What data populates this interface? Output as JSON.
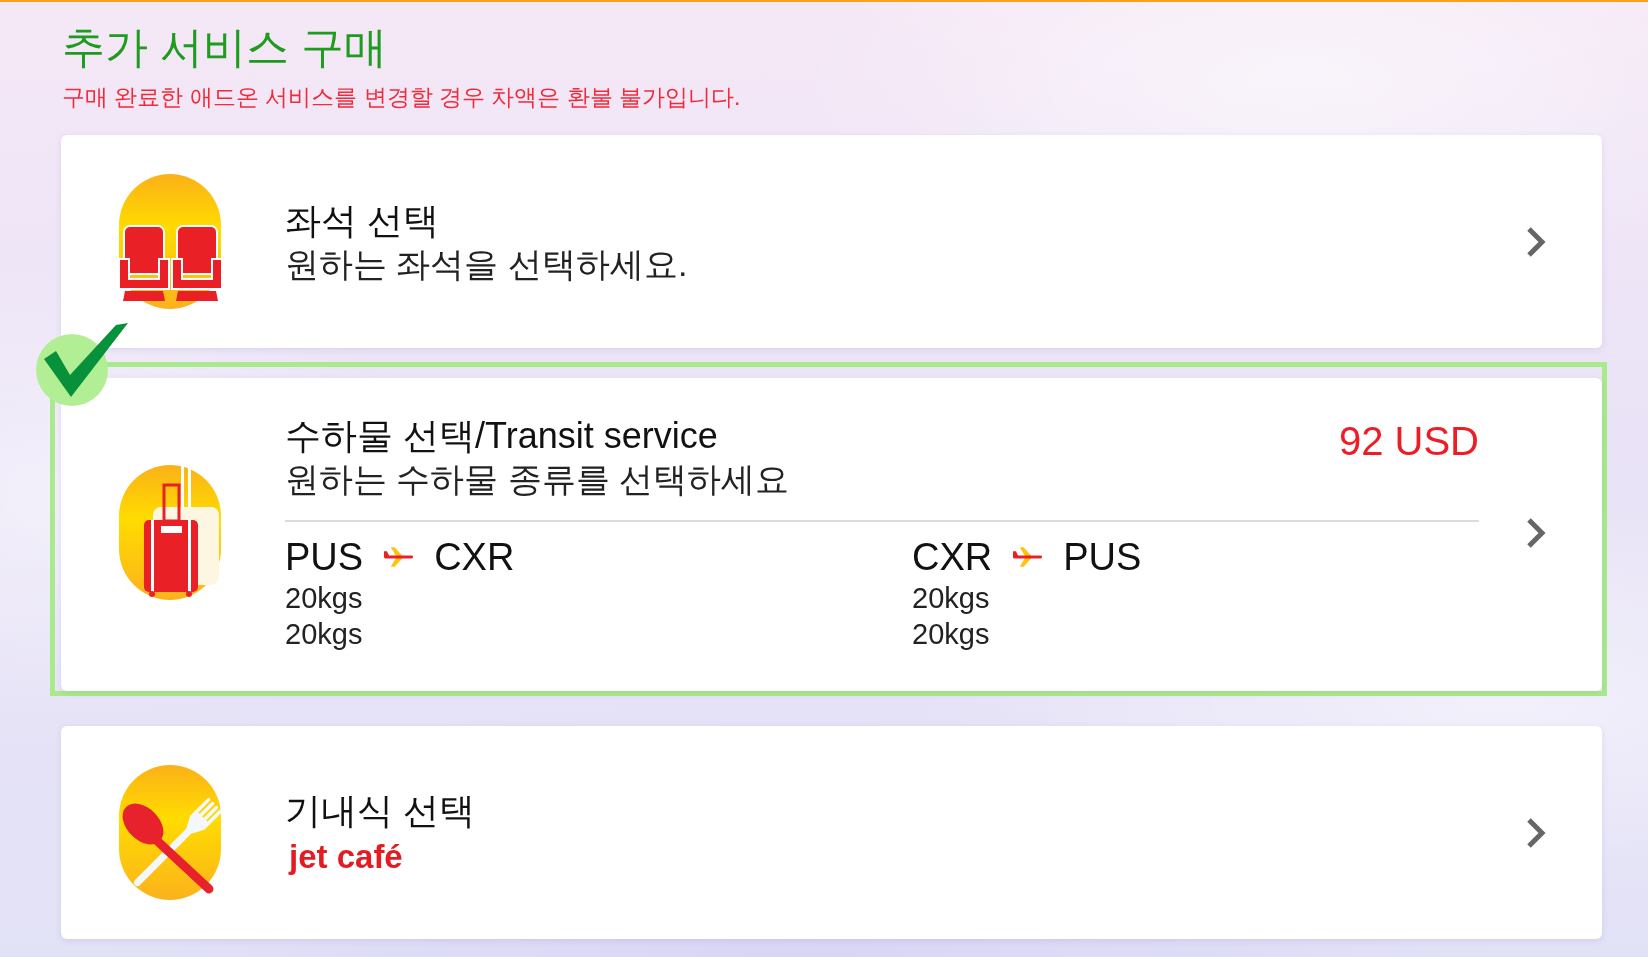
{
  "header": {
    "title": "추가 서비스 구매",
    "notice": "구매 완료한 애드온 서비스를 변경할 경우 차액은 환불 불가입니다."
  },
  "services": [
    {
      "kind": "seat",
      "selected": false,
      "title": "좌석 선택",
      "description": "원하는 좌석을 선택하세요."
    },
    {
      "kind": "baggage",
      "selected": true,
      "title": "수하물 선택/Transit service",
      "description": "원하는 수하물 종류를 선택하세요",
      "price": "92 USD",
      "routes": [
        {
          "origin": "PUS",
          "destination": "CXR",
          "allowances": [
            "20kgs",
            "20kgs"
          ]
        },
        {
          "origin": "CXR",
          "destination": "PUS",
          "allowances": [
            "20kgs",
            "20kgs"
          ]
        }
      ]
    },
    {
      "kind": "meal",
      "selected": false,
      "title": "기내식 선택",
      "brand": "jet café"
    }
  ]
}
